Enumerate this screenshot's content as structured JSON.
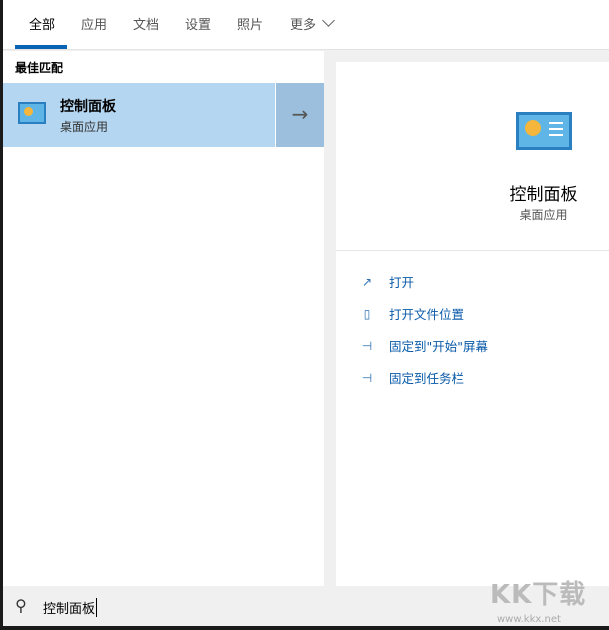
{
  "tabs": [
    {
      "label": "全部"
    },
    {
      "label": "应用"
    },
    {
      "label": "文档"
    },
    {
      "label": "设置"
    },
    {
      "label": "照片"
    },
    {
      "label": "更多"
    }
  ],
  "results": {
    "section_title": "最佳匹配",
    "best": {
      "title": "控制面板",
      "subtitle": "桌面应用",
      "icon": "control-panel-icon"
    }
  },
  "preview": {
    "title": "控制面板",
    "subtitle": "桌面应用",
    "actions": [
      {
        "label": "打开",
        "icon": "open-icon"
      },
      {
        "label": "打开文件位置",
        "icon": "file-location-icon"
      },
      {
        "label": "固定到\"开始\"屏幕",
        "icon": "pin-icon"
      },
      {
        "label": "固定到任务栏",
        "icon": "pin-icon"
      }
    ]
  },
  "search": {
    "value": "控制面板"
  },
  "watermark": {
    "text": "KK下载",
    "url": "www.kkx.net"
  },
  "colors": {
    "accent": "#0a64b4",
    "selected": "#b5d6f0",
    "link": "#0a5aa8"
  }
}
